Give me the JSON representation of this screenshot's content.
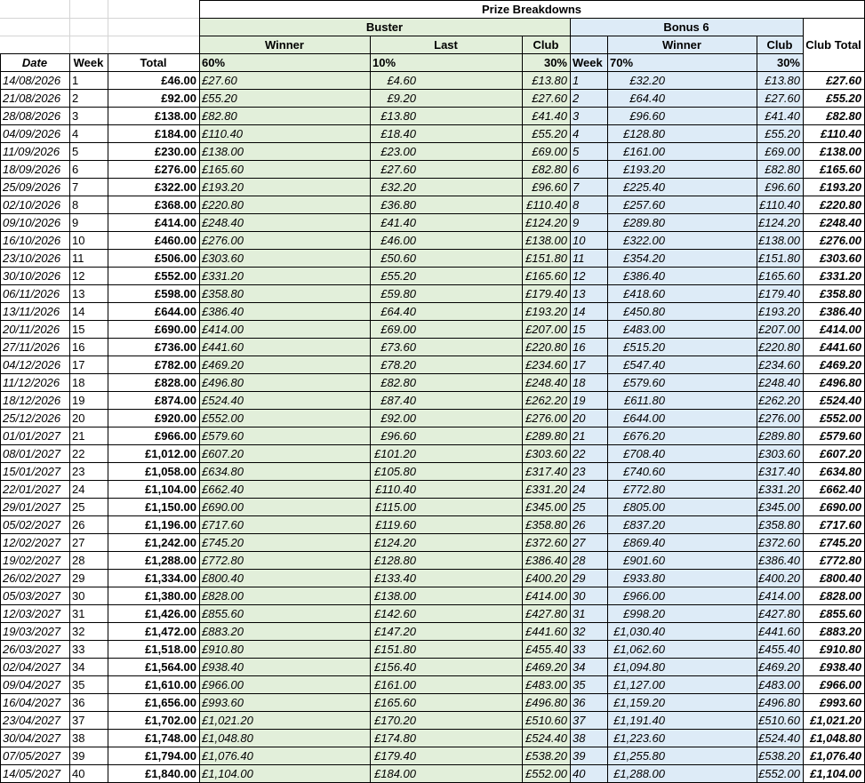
{
  "sheet": {
    "fills": {
      "buster": "#e2efda",
      "bonus": "#ddebf7",
      "border": "#000000",
      "gridline": "#d4d4d4"
    },
    "headers": {
      "title": "Prize Breakdowns",
      "buster": "Buster",
      "bonus6": "Bonus 6",
      "buster_winner": "Winner",
      "buster_last": "Last",
      "buster_club": "Club",
      "bonus_winner": "Winner",
      "bonus_club": "Club",
      "club_total": "Club Total",
      "date": "Date",
      "week": "Week",
      "total": "Total",
      "pct_winner": "60%",
      "pct_last": "10%",
      "pct_club": "30%",
      "bonus_week": "Week",
      "pct_bonus_winner": "70%",
      "pct_bonus_club": "30%"
    },
    "rows": [
      {
        "date": "14/08/2026",
        "week": "1",
        "total": "£46.00",
        "bw": "£27.60",
        "bl": "£4.60",
        "bc": "£13.80",
        "wk2": "1",
        "bnw": "£32.20",
        "bnc": "£13.80",
        "ct": "£27.60"
      },
      {
        "date": "21/08/2026",
        "week": "2",
        "total": "£92.00",
        "bw": "£55.20",
        "bl": "£9.20",
        "bc": "£27.60",
        "wk2": "2",
        "bnw": "£64.40",
        "bnc": "£27.60",
        "ct": "£55.20"
      },
      {
        "date": "28/08/2026",
        "week": "3",
        "total": "£138.00",
        "bw": "£82.80",
        "bl": "£13.80",
        "bc": "£41.40",
        "wk2": "3",
        "bnw": "£96.60",
        "bnc": "£41.40",
        "ct": "£82.80"
      },
      {
        "date": "04/09/2026",
        "week": "4",
        "total": "£184.00",
        "bw": "£110.40",
        "bl": "£18.40",
        "bc": "£55.20",
        "wk2": "4",
        "bnw": "£128.80",
        "bnc": "£55.20",
        "ct": "£110.40"
      },
      {
        "date": "11/09/2026",
        "week": "5",
        "total": "£230.00",
        "bw": "£138.00",
        "bl": "£23.00",
        "bc": "£69.00",
        "wk2": "5",
        "bnw": "£161.00",
        "bnc": "£69.00",
        "ct": "£138.00"
      },
      {
        "date": "18/09/2026",
        "week": "6",
        "total": "£276.00",
        "bw": "£165.60",
        "bl": "£27.60",
        "bc": "£82.80",
        "wk2": "6",
        "bnw": "£193.20",
        "bnc": "£82.80",
        "ct": "£165.60"
      },
      {
        "date": "25/09/2026",
        "week": "7",
        "total": "£322.00",
        "bw": "£193.20",
        "bl": "£32.20",
        "bc": "£96.60",
        "wk2": "7",
        "bnw": "£225.40",
        "bnc": "£96.60",
        "ct": "£193.20"
      },
      {
        "date": "02/10/2026",
        "week": "8",
        "total": "£368.00",
        "bw": "£220.80",
        "bl": "£36.80",
        "bc": "£110.40",
        "wk2": "8",
        "bnw": "£257.60",
        "bnc": "£110.40",
        "ct": "£220.80"
      },
      {
        "date": "09/10/2026",
        "week": "9",
        "total": "£414.00",
        "bw": "£248.40",
        "bl": "£41.40",
        "bc": "£124.20",
        "wk2": "9",
        "bnw": "£289.80",
        "bnc": "£124.20",
        "ct": "£248.40"
      },
      {
        "date": "16/10/2026",
        "week": "10",
        "total": "£460.00",
        "bw": "£276.00",
        "bl": "£46.00",
        "bc": "£138.00",
        "wk2": "10",
        "bnw": "£322.00",
        "bnc": "£138.00",
        "ct": "£276.00"
      },
      {
        "date": "23/10/2026",
        "week": "11",
        "total": "£506.00",
        "bw": "£303.60",
        "bl": "£50.60",
        "bc": "£151.80",
        "wk2": "11",
        "bnw": "£354.20",
        "bnc": "£151.80",
        "ct": "£303.60"
      },
      {
        "date": "30/10/2026",
        "week": "12",
        "total": "£552.00",
        "bw": "£331.20",
        "bl": "£55.20",
        "bc": "£165.60",
        "wk2": "12",
        "bnw": "£386.40",
        "bnc": "£165.60",
        "ct": "£331.20"
      },
      {
        "date": "06/11/2026",
        "week": "13",
        "total": "£598.00",
        "bw": "£358.80",
        "bl": "£59.80",
        "bc": "£179.40",
        "wk2": "13",
        "bnw": "£418.60",
        "bnc": "£179.40",
        "ct": "£358.80"
      },
      {
        "date": "13/11/2026",
        "week": "14",
        "total": "£644.00",
        "bw": "£386.40",
        "bl": "£64.40",
        "bc": "£193.20",
        "wk2": "14",
        "bnw": "£450.80",
        "bnc": "£193.20",
        "ct": "£386.40"
      },
      {
        "date": "20/11/2026",
        "week": "15",
        "total": "£690.00",
        "bw": "£414.00",
        "bl": "£69.00",
        "bc": "£207.00",
        "wk2": "15",
        "bnw": "£483.00",
        "bnc": "£207.00",
        "ct": "£414.00"
      },
      {
        "date": "27/11/2026",
        "week": "16",
        "total": "£736.00",
        "bw": "£441.60",
        "bl": "£73.60",
        "bc": "£220.80",
        "wk2": "16",
        "bnw": "£515.20",
        "bnc": "£220.80",
        "ct": "£441.60"
      },
      {
        "date": "04/12/2026",
        "week": "17",
        "total": "£782.00",
        "bw": "£469.20",
        "bl": "£78.20",
        "bc": "£234.60",
        "wk2": "17",
        "bnw": "£547.40",
        "bnc": "£234.60",
        "ct": "£469.20"
      },
      {
        "date": "11/12/2026",
        "week": "18",
        "total": "£828.00",
        "bw": "£496.80",
        "bl": "£82.80",
        "bc": "£248.40",
        "wk2": "18",
        "bnw": "£579.60",
        "bnc": "£248.40",
        "ct": "£496.80"
      },
      {
        "date": "18/12/2026",
        "week": "19",
        "total": "£874.00",
        "bw": "£524.40",
        "bl": "£87.40",
        "bc": "£262.20",
        "wk2": "19",
        "bnw": "£611.80",
        "bnc": "£262.20",
        "ct": "£524.40"
      },
      {
        "date": "25/12/2026",
        "week": "20",
        "total": "£920.00",
        "bw": "£552.00",
        "bl": "£92.00",
        "bc": "£276.00",
        "wk2": "20",
        "bnw": "£644.00",
        "bnc": "£276.00",
        "ct": "£552.00"
      },
      {
        "date": "01/01/2027",
        "week": "21",
        "total": "£966.00",
        "bw": "£579.60",
        "bl": "£96.60",
        "bc": "£289.80",
        "wk2": "21",
        "bnw": "£676.20",
        "bnc": "£289.80",
        "ct": "£579.60"
      },
      {
        "date": "08/01/2027",
        "week": "22",
        "total": "£1,012.00",
        "bw": "£607.20",
        "bl": "£101.20",
        "bc": "£303.60",
        "wk2": "22",
        "bnw": "£708.40",
        "bnc": "£303.60",
        "ct": "£607.20"
      },
      {
        "date": "15/01/2027",
        "week": "23",
        "total": "£1,058.00",
        "bw": "£634.80",
        "bl": "£105.80",
        "bc": "£317.40",
        "wk2": "23",
        "bnw": "£740.60",
        "bnc": "£317.40",
        "ct": "£634.80"
      },
      {
        "date": "22/01/2027",
        "week": "24",
        "total": "£1,104.00",
        "bw": "£662.40",
        "bl": "£110.40",
        "bc": "£331.20",
        "wk2": "24",
        "bnw": "£772.80",
        "bnc": "£331.20",
        "ct": "£662.40"
      },
      {
        "date": "29/01/2027",
        "week": "25",
        "total": "£1,150.00",
        "bw": "£690.00",
        "bl": "£115.00",
        "bc": "£345.00",
        "wk2": "25",
        "bnw": "£805.00",
        "bnc": "£345.00",
        "ct": "£690.00"
      },
      {
        "date": "05/02/2027",
        "week": "26",
        "total": "£1,196.00",
        "bw": "£717.60",
        "bl": "£119.60",
        "bc": "£358.80",
        "wk2": "26",
        "bnw": "£837.20",
        "bnc": "£358.80",
        "ct": "£717.60"
      },
      {
        "date": "12/02/2027",
        "week": "27",
        "total": "£1,242.00",
        "bw": "£745.20",
        "bl": "£124.20",
        "bc": "£372.60",
        "wk2": "27",
        "bnw": "£869.40",
        "bnc": "£372.60",
        "ct": "£745.20"
      },
      {
        "date": "19/02/2027",
        "week": "28",
        "total": "£1,288.00",
        "bw": "£772.80",
        "bl": "£128.80",
        "bc": "£386.40",
        "wk2": "28",
        "bnw": "£901.60",
        "bnc": "£386.40",
        "ct": "£772.80"
      },
      {
        "date": "26/02/2027",
        "week": "29",
        "total": "£1,334.00",
        "bw": "£800.40",
        "bl": "£133.40",
        "bc": "£400.20",
        "wk2": "29",
        "bnw": "£933.80",
        "bnc": "£400.20",
        "ct": "£800.40"
      },
      {
        "date": "05/03/2027",
        "week": "30",
        "total": "£1,380.00",
        "bw": "£828.00",
        "bl": "£138.00",
        "bc": "£414.00",
        "wk2": "30",
        "bnw": "£966.00",
        "bnc": "£414.00",
        "ct": "£828.00"
      },
      {
        "date": "12/03/2027",
        "week": "31",
        "total": "£1,426.00",
        "bw": "£855.60",
        "bl": "£142.60",
        "bc": "£427.80",
        "wk2": "31",
        "bnw": "£998.20",
        "bnc": "£427.80",
        "ct": "£855.60"
      },
      {
        "date": "19/03/2027",
        "week": "32",
        "total": "£1,472.00",
        "bw": "£883.20",
        "bl": "£147.20",
        "bc": "£441.60",
        "wk2": "32",
        "bnw": "£1,030.40",
        "bnc": "£441.60",
        "ct": "£883.20"
      },
      {
        "date": "26/03/2027",
        "week": "33",
        "total": "£1,518.00",
        "bw": "£910.80",
        "bl": "£151.80",
        "bc": "£455.40",
        "wk2": "33",
        "bnw": "£1,062.60",
        "bnc": "£455.40",
        "ct": "£910.80"
      },
      {
        "date": "02/04/2027",
        "week": "34",
        "total": "£1,564.00",
        "bw": "£938.40",
        "bl": "£156.40",
        "bc": "£469.20",
        "wk2": "34",
        "bnw": "£1,094.80",
        "bnc": "£469.20",
        "ct": "£938.40"
      },
      {
        "date": "09/04/2027",
        "week": "35",
        "total": "£1,610.00",
        "bw": "£966.00",
        "bl": "£161.00",
        "bc": "£483.00",
        "wk2": "35",
        "bnw": "£1,127.00",
        "bnc": "£483.00",
        "ct": "£966.00"
      },
      {
        "date": "16/04/2027",
        "week": "36",
        "total": "£1,656.00",
        "bw": "£993.60",
        "bl": "£165.60",
        "bc": "£496.80",
        "wk2": "36",
        "bnw": "£1,159.20",
        "bnc": "£496.80",
        "ct": "£993.60"
      },
      {
        "date": "23/04/2027",
        "week": "37",
        "total": "£1,702.00",
        "bw": "£1,021.20",
        "bl": "£170.20",
        "bc": "£510.60",
        "wk2": "37",
        "bnw": "£1,191.40",
        "bnc": "£510.60",
        "ct": "£1,021.20"
      },
      {
        "date": "30/04/2027",
        "week": "38",
        "total": "£1,748.00",
        "bw": "£1,048.80",
        "bl": "£174.80",
        "bc": "£524.40",
        "wk2": "38",
        "bnw": "£1,223.60",
        "bnc": "£524.40",
        "ct": "£1,048.80"
      },
      {
        "date": "07/05/2027",
        "week": "39",
        "total": "£1,794.00",
        "bw": "£1,076.40",
        "bl": "£179.40",
        "bc": "£538.20",
        "wk2": "39",
        "bnw": "£1,255.80",
        "bnc": "£538.20",
        "ct": "£1,076.40"
      },
      {
        "date": "14/05/2027",
        "week": "40",
        "total": "£1,840.00",
        "bw": "£1,104.00",
        "bl": "£184.00",
        "bc": "£552.00",
        "wk2": "40",
        "bnw": "£1,288.00",
        "bnc": "£552.00",
        "ct": "£1,104.00"
      }
    ]
  }
}
